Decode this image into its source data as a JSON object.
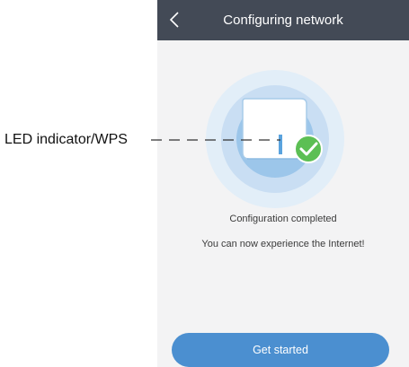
{
  "annotation": {
    "label": "LED indicator/WPS"
  },
  "header": {
    "title": "Configuring network",
    "back_icon": "chevron-left-icon"
  },
  "status": {
    "line1": "Configuration completed",
    "line2": "You can now experience the Internet!"
  },
  "actions": {
    "primary_label": "Get started"
  },
  "colors": {
    "header_bg": "#434a56",
    "screen_bg": "#f3f3f4",
    "accent": "#4b8fd0",
    "success": "#5cbf54",
    "ring_outer": "#d9eaf6",
    "ring_mid": "#b9d6ef",
    "ring_inner": "#8cbce6"
  }
}
